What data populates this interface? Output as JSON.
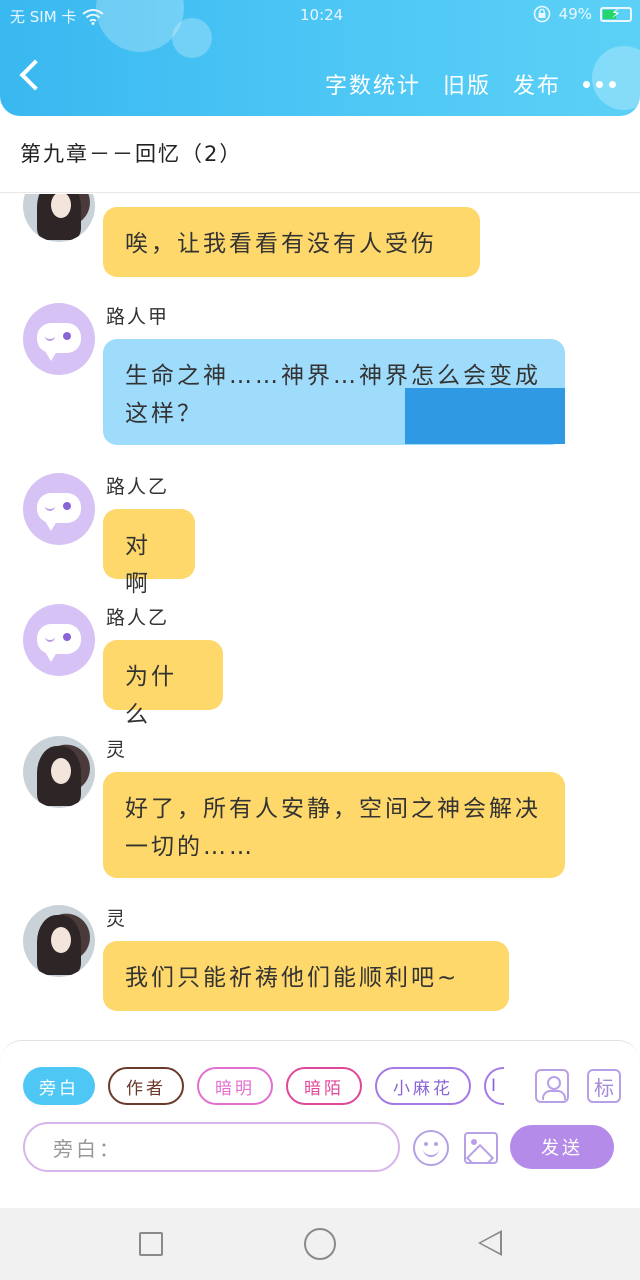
{
  "status_bar": {
    "carrier": "无 SIM 卡",
    "time": "10:24",
    "battery": "49%",
    "battery_level": 0.49,
    "icons": [
      "wifi-icon",
      "lock-rotation-icon",
      "battery-charging-icon"
    ]
  },
  "header": {
    "actions": [
      "字数统计",
      "旧版",
      "发布"
    ],
    "back_icon": "chevron-left-icon",
    "more_icon": "more-dots-icon"
  },
  "chapter": {
    "title": "第九章－－回忆（2）"
  },
  "messages": [
    {
      "sender": "",
      "text": "唉，让我看看有没有人受伤",
      "avatar": "photo",
      "bubble_color": "#fed86a"
    },
    {
      "sender": "路人甲",
      "text": "生命之神……神界…神界怎么会变成这样？",
      "avatar": "chat-bubble",
      "bubble_color": "#9fdcfb"
    },
    {
      "sender": "路人乙",
      "text": "对啊",
      "avatar": "chat-bubble",
      "bubble_color": "#fed86a"
    },
    {
      "sender": "路人乙",
      "text": "为什么",
      "avatar": "chat-bubble",
      "bubble_color": "#fed86a"
    },
    {
      "sender": "灵",
      "text": "好了，所有人安静，空间之神会解决一切的……",
      "avatar": "photo",
      "bubble_color": "#fed86a"
    },
    {
      "sender": "灵",
      "text": "我们只能祈祷他们能顺利吧~",
      "avatar": "photo",
      "bubble_color": "#fed86a"
    }
  ],
  "input_panel": {
    "roles": [
      "旁白",
      "作者",
      "暗明",
      "暗陌",
      "小麻花",
      "Ⅰ"
    ],
    "active_role": "旁白",
    "tag_label": "标",
    "input_placeholder": "旁白：",
    "send_label": "发送"
  },
  "colors": {
    "header_gradient_start": "#39b8f0",
    "header_gradient_end": "#5cd1f7",
    "bubble_yellow": "#fed86a",
    "bubble_blue": "#9fdcfb",
    "send_button": "#b58bea",
    "avatar_purple": "#d6c2f4"
  }
}
